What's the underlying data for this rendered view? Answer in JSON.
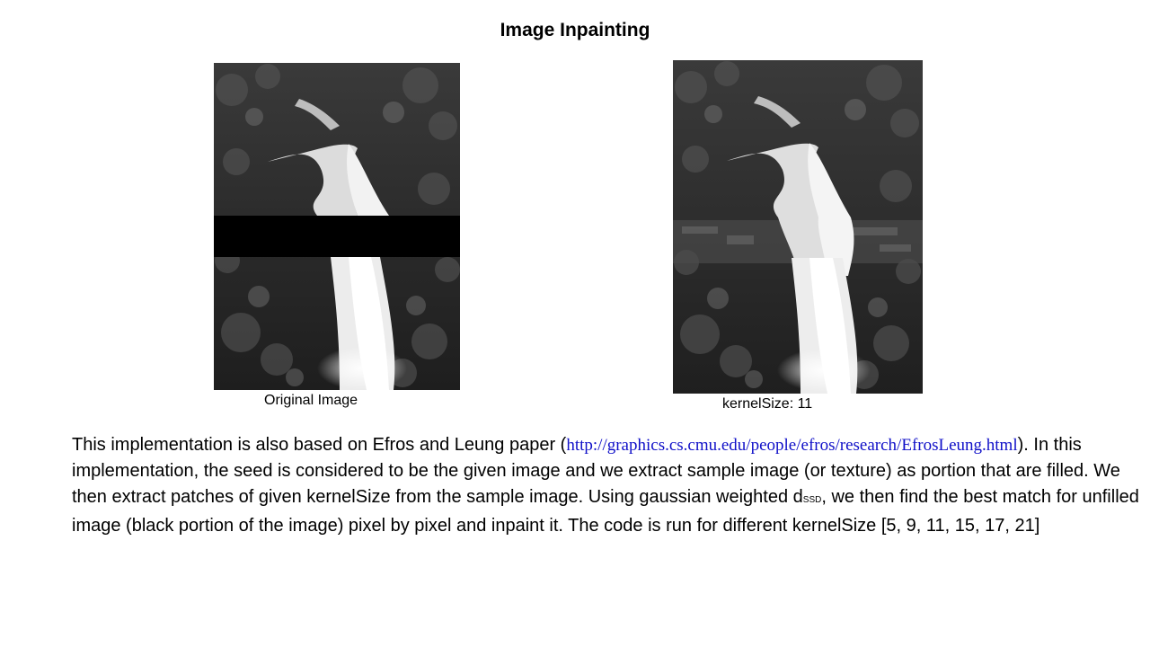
{
  "slide": {
    "title": "Image Inpainting"
  },
  "figures": {
    "left": {
      "caption": "Original Image",
      "masked_region": "black horizontal band across the image"
    },
    "right": {
      "caption": "kernelSize: 11"
    }
  },
  "body": {
    "p1_before_link": "This implementation is also based on Efros and Leung paper (",
    "link": "http://graphics.cs.cmu.edu/people/efros/research/EfrosLeung.html",
    "p1_after_link": ").",
    "p2": "In this implementation, the seed is considered to be the given image and we extract sample image (or texture) as portion that are filled. We then extract patches of given kernelSize from the sample image. Using gaussian weighted d",
    "subscript": "SSD",
    "p3": ", we then find the best match for unfilled image (black portion of the image) pixel by pixel and inpaint it. The code is run for different kernelSize [5, 9, 11, 15, 17, 21]"
  },
  "colors": {
    "link": "#1010c8",
    "mask": "#000000"
  }
}
